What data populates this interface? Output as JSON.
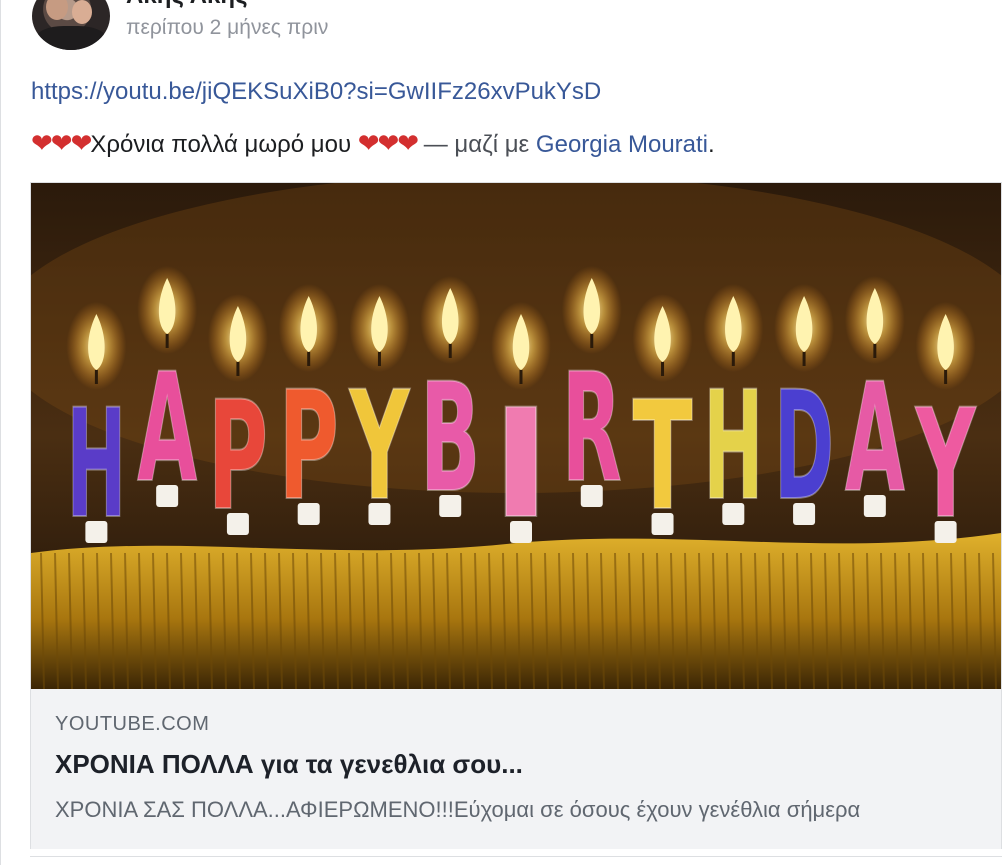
{
  "post": {
    "author": "Ακης Ακης",
    "timestamp": "περίπου 2 μήνες πριν",
    "link_url": "https://youtu.be/jiQEKSuXiB0?si=GwIIFz26xvPukYsD",
    "caption": {
      "hearts_before": "❤❤❤",
      "text": "Χρόνια πολλά μωρό μου ",
      "hearts_after": "❤❤❤",
      "with_prefix": " — μαζί με ",
      "tagged_person": "Georgia Mourati",
      "end": "."
    }
  },
  "preview": {
    "image_letters": [
      "H",
      "A",
      "P",
      "P",
      "Y",
      "B",
      "I",
      "R",
      "T",
      "H",
      "D",
      "A",
      "Y"
    ],
    "domain": "YOUTUBE.COM",
    "title": "ΧΡΟΝΙΑ ΠΟΛΛΑ για τα γενεθλια σου...",
    "description": "ΧΡΟΝΙΑ ΣΑΣ ΠΟΛΛΑ...ΑΦΙΕΡΩΜΕΝΟ!!!Εύχομαι σε όσους έχουν γενέθλια σήμερα"
  },
  "icons": {
    "brand": "facebook-logo-icon",
    "brand_color": "#1877f2",
    "heart_color": "#d32f2f"
  },
  "colors": {
    "link": "#385898",
    "muted_text": "#90949c",
    "card_bg": "#f2f3f5"
  }
}
